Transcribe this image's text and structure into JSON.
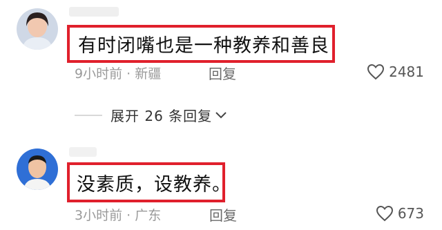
{
  "comments": [
    {
      "text": "有时闭嘴也是一种教养和善良",
      "time": "9小时前",
      "separator": " · ",
      "location": "新疆",
      "reply": "回复",
      "likes": "2481"
    },
    {
      "text": "没素质，设教养。",
      "time": "3小时前",
      "separator": " · ",
      "location": "广东",
      "reply": "回复",
      "likes": "673"
    }
  ],
  "expand": {
    "label": "展开 26 条回复"
  },
  "icons": {
    "like": "heart-outline-icon",
    "expand": "chevron-down-icon"
  },
  "colors": {
    "highlight_border": "#e0202c"
  }
}
